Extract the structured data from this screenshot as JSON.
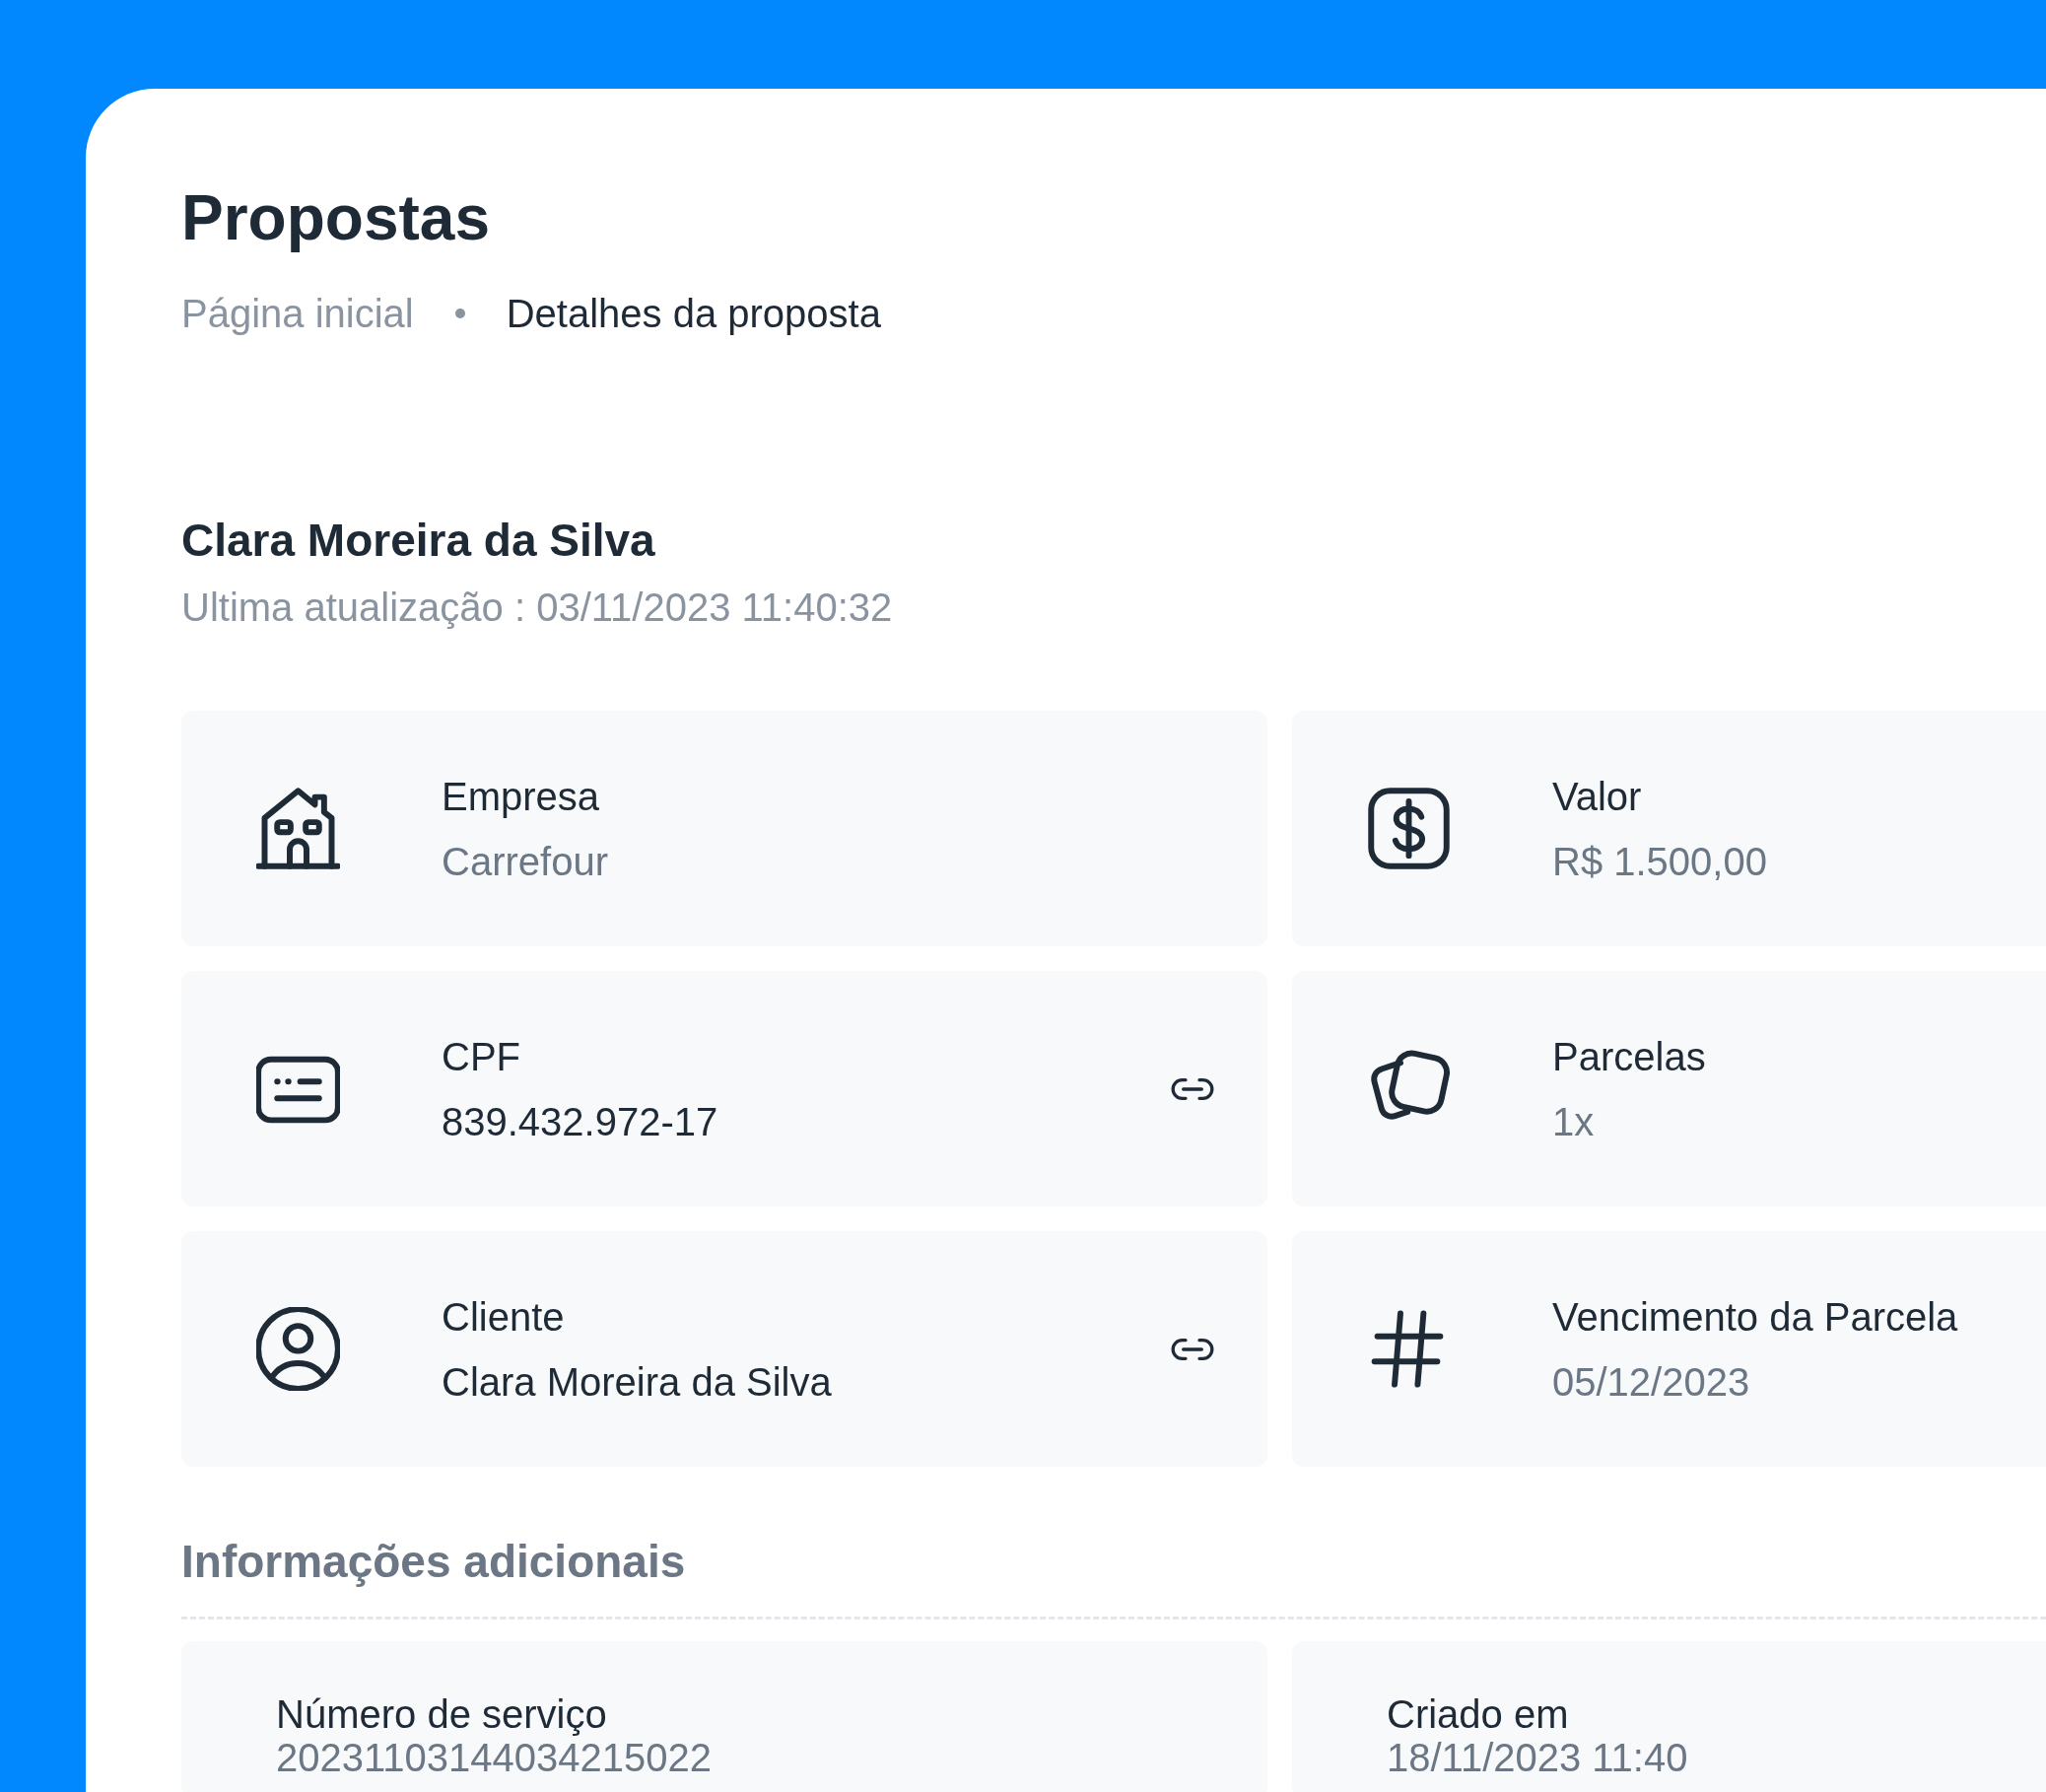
{
  "header": {
    "title": "Propostas",
    "breadcrumb": [
      {
        "label": "Página inicial",
        "current": false
      },
      {
        "label": "Detalhes da proposta",
        "current": true
      }
    ]
  },
  "proposal": {
    "name": "Clara Moreira da Silva",
    "updated": "Ultima atualização : 03/11/2023 11:40:32"
  },
  "fields": [
    {
      "kind": "building",
      "label": "Empresa",
      "value": "Carrefour",
      "muted": true,
      "link": false
    },
    {
      "kind": "dollar",
      "label": "Valor",
      "value": "R$ 1.500,00",
      "muted": true,
      "link": false
    },
    {
      "kind": "card",
      "label": "CPF",
      "value": "839.432.972-17",
      "muted": false,
      "link": true
    },
    {
      "kind": "stack",
      "label": "Parcelas",
      "value": "1x",
      "muted": true,
      "link": false
    },
    {
      "kind": "user",
      "label": "Cliente",
      "value": "Clara Moreira da Silva",
      "muted": false,
      "link": true
    },
    {
      "kind": "hash",
      "label": "Vencimento da Parcela",
      "value": "05/12/2023",
      "muted": true,
      "link": false
    }
  ],
  "additional": {
    "title": "Informações adicionais",
    "items": [
      {
        "label": "Número de serviço",
        "value": "20231103144034215022"
      },
      {
        "label": "Criado em",
        "value": "18/11/2023 11:40"
      }
    ]
  }
}
